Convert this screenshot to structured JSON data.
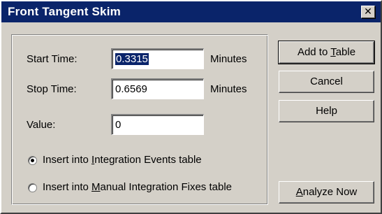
{
  "dialog": {
    "title": "Front Tangent Skim",
    "close_glyph": "✕"
  },
  "fields": {
    "start_time": {
      "label": "Start Time:",
      "value": "0.3315",
      "unit": "Minutes"
    },
    "stop_time": {
      "label": "Stop Time:",
      "value": "0.6569",
      "unit": "Minutes"
    },
    "value": {
      "label": "Value:",
      "value": "0"
    }
  },
  "radio": {
    "integration_events": {
      "pre": "Insert into ",
      "mnemonic": "I",
      "post": "ntegration Events table",
      "selected": true
    },
    "manual_fixes": {
      "pre": "Insert into ",
      "mnemonic": "M",
      "post": "anual Integration Fixes table",
      "selected": false
    }
  },
  "buttons": {
    "add_to_table": {
      "pre": "Add to ",
      "mnemonic": "T",
      "post": "able"
    },
    "cancel": {
      "label": "Cancel"
    },
    "help": {
      "label": "Help"
    },
    "analyze_now": {
      "pre": "",
      "mnemonic": "A",
      "post": "nalyze Now"
    }
  },
  "icons": {
    "close": "close-icon",
    "radio_selected": "radio-selected-icon",
    "radio_unselected": "radio-unselected-icon"
  },
  "colors": {
    "titlebar": "#0a246a",
    "face": "#d4d0c8",
    "selection": "#0a246a"
  }
}
